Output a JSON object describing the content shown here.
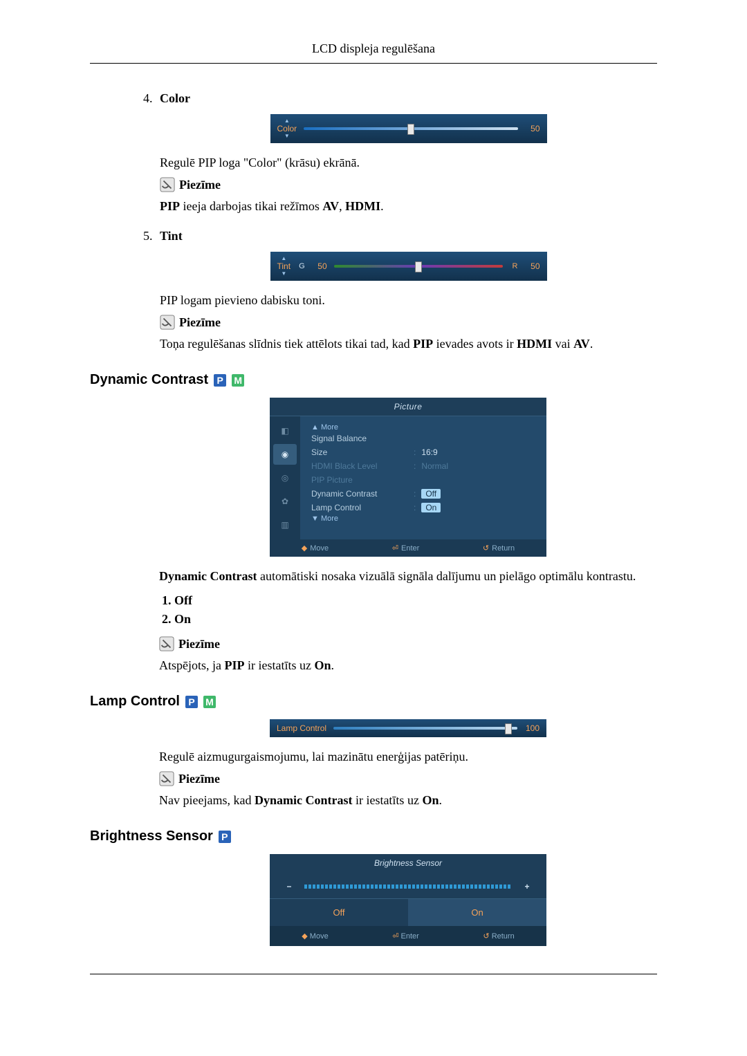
{
  "header": {
    "title": "LCD displeja regulēšana"
  },
  "color_item": {
    "number": "4",
    "title": "Color",
    "slider": {
      "label": "Color",
      "value": "50",
      "thumb_pct": 50
    },
    "desc": "Regulē PIP loga \"Color\" (krāsu) ekrānā.",
    "note_label": "Piezīme",
    "note_prefix": "PIP",
    "note_mid": " ieeja darbojas tikai režīmos ",
    "note_b1": "AV",
    "note_sep": ", ",
    "note_b2": "HDMI",
    "note_end": "."
  },
  "tint_item": {
    "number": "5",
    "title": "Tint",
    "slider": {
      "label": "Tint",
      "g_label": "G",
      "g_val": "50",
      "r_label": "R",
      "r_val": "50",
      "thumb_pct": 50
    },
    "desc": "PIP logam pievieno dabisku toni.",
    "note_label": "Piezīme",
    "note_pre": "Toņa regulēšanas slīdnis tiek attēlots tikai tad, kad ",
    "note_b1": "PIP",
    "note_mid": " ievades avots ir ",
    "note_b2": "HDMI",
    "note_or": " vai ",
    "note_b3": "AV",
    "note_end": "."
  },
  "dynamic": {
    "heading": "Dynamic Contrast",
    "menu_title": "Picture",
    "more_up": "▲ More",
    "rows": [
      {
        "lab": "Signal Balance",
        "val": ""
      },
      {
        "lab": "Size",
        "val": "16:9"
      },
      {
        "lab": "HDMI Black Level",
        "val": "Normal",
        "dim": true
      },
      {
        "lab": "PIP Picture",
        "val": "",
        "dim": true
      },
      {
        "lab": "Dynamic Contrast",
        "val": "Off",
        "hl": true
      },
      {
        "lab": "Lamp Control",
        "val": "On",
        "hl": true
      }
    ],
    "more_down": "▼ More",
    "footer": {
      "move": "Move",
      "enter": "Enter",
      "return": "Return"
    },
    "desc_b": "Dynamic Contrast",
    "desc_rest": " automātiski nosaka vizuālā signāla dalījumu un pielāgo optimālu kontrastu.",
    "opts": [
      "Off",
      "On"
    ],
    "note_label": "Piezīme",
    "note_pre": "Atspējots, ja ",
    "note_b": "PIP",
    "note_mid": " ir iestatīts uz ",
    "note_b2": "On",
    "note_end": "."
  },
  "lamp": {
    "heading": "Lamp Control",
    "slider": {
      "label": "Lamp Control",
      "value": "100",
      "thumb_pct": 95
    },
    "desc": "Regulē aizmugurgaismojumu, lai mazinātu enerģijas patēriņu.",
    "note_label": "Piezīme",
    "note_pre": "Nav pieejams, kad ",
    "note_b": "Dynamic Contrast",
    "note_mid": " ir iestatīts uz ",
    "note_b2": "On",
    "note_end": "."
  },
  "brightness": {
    "heading": "Brightness Sensor",
    "menu_title": "Brightness Sensor",
    "minus": "−",
    "plus": "+",
    "off_label": "Off",
    "on_label": "On",
    "footer": {
      "move": "Move",
      "enter": "Enter",
      "return": "Return"
    }
  }
}
